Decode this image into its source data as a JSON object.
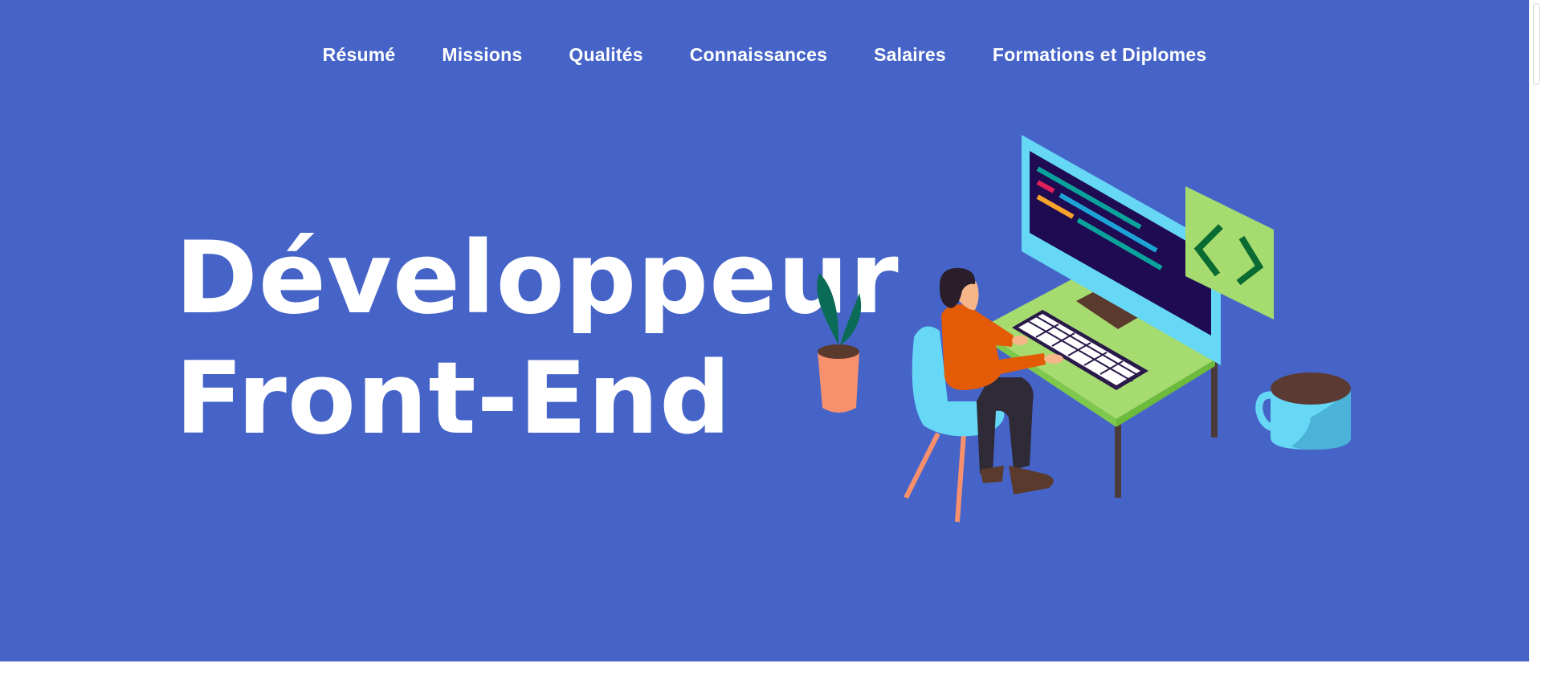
{
  "nav": {
    "items": [
      {
        "label": "Résumé"
      },
      {
        "label": "Missions"
      },
      {
        "label": "Qualités"
      },
      {
        "label": "Connaissances"
      },
      {
        "label": "Salaires"
      },
      {
        "label": "Formations et Diplomes"
      }
    ]
  },
  "hero": {
    "title_line1": "Développeur",
    "title_line2": "Front-End"
  },
  "colors": {
    "hero_bg": "#4664c8",
    "text": "#ffffff",
    "desk": "#a6db6f",
    "monitor_frame": "#66d8f6",
    "screen": "#1e0b51",
    "shirt": "#e35b06",
    "chair": "#66d8f6",
    "pot": "#f7906c",
    "code_card": "#a6db6f",
    "code_symbol": "#0a6b32"
  },
  "icons": {
    "code": "code-brackets-icon"
  }
}
